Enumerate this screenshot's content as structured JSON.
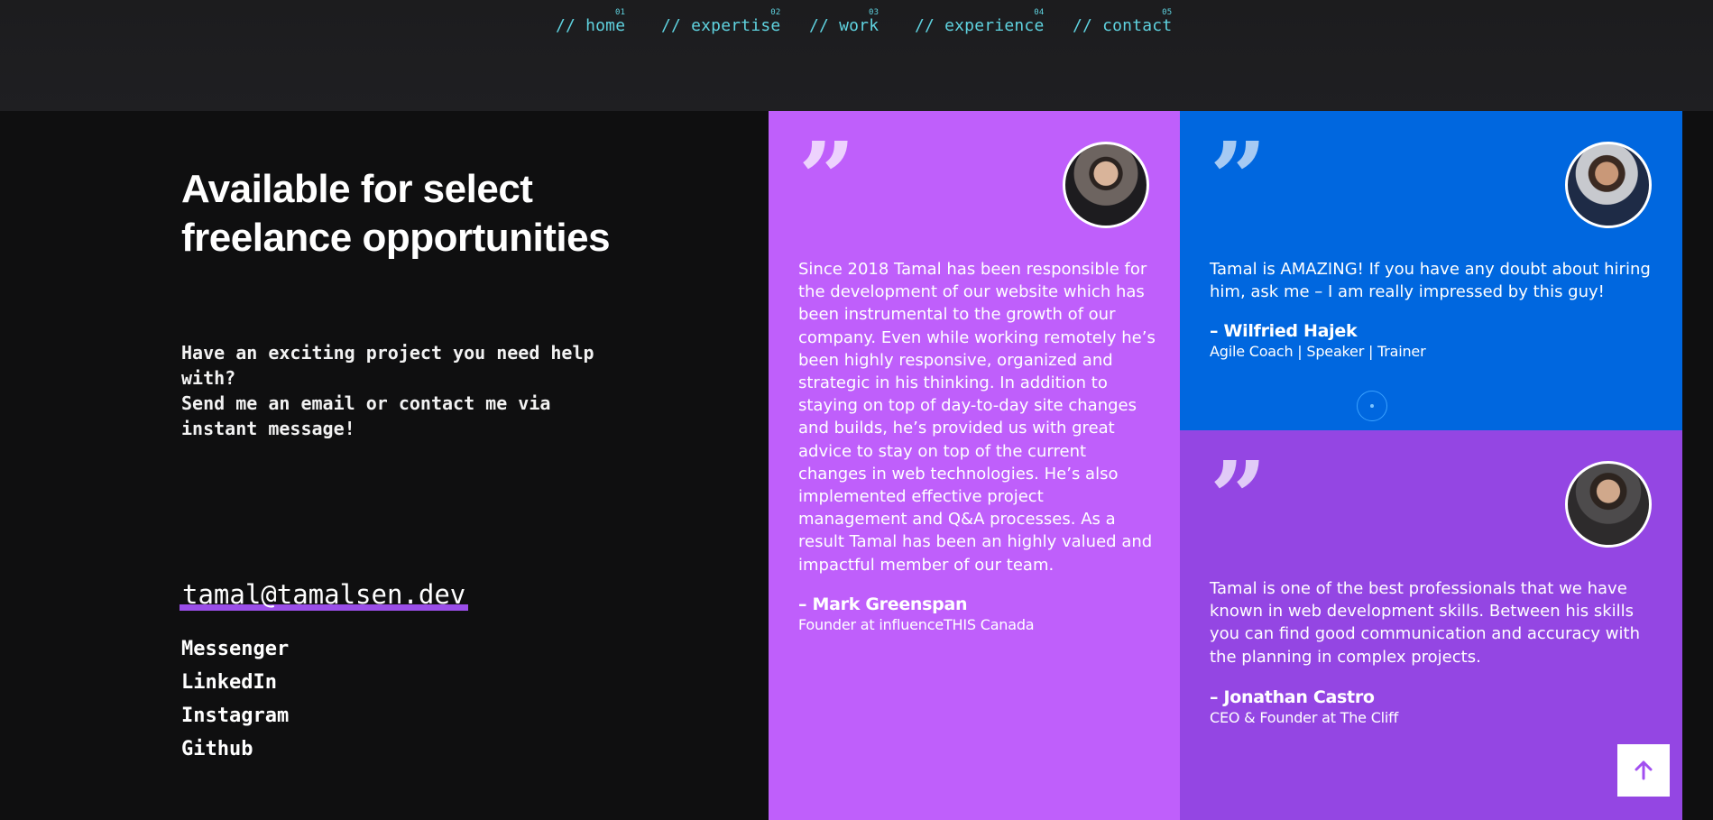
{
  "nav": {
    "items": [
      {
        "label": "// home",
        "num": "01"
      },
      {
        "label": "// expertise",
        "num": "02"
      },
      {
        "label": "// work",
        "num": "03"
      },
      {
        "label": "// experience",
        "num": "04"
      },
      {
        "label": "// contact",
        "num": "05"
      }
    ]
  },
  "contact": {
    "headline": "Available for select freelance opportunities",
    "intro": [
      "Have an exciting project you need help with?",
      "Send me an email or contact me via instant message!"
    ],
    "email": "tamal@tamalsen.dev",
    "social": [
      "Messenger",
      "LinkedIn",
      "Instagram",
      "Github"
    ]
  },
  "testimonials": [
    {
      "quote": "Since 2018 Tamal has been responsible for the development of our website which has been instrumental to the growth of our company. Even while working remotely he’s been highly responsive, organized and strategic in his thinking. In addition to staying on top of day-to-day site changes and builds, he’s provided us with great advice to stay on top of the current changes in web technologies. He’s also implemented effective project management and Q&A processes. As a result Tamal has been an highly valued and impactful member of our team.",
      "author": "– Mark Greenspan",
      "role": "Founder at influenceTHIS Canada"
    },
    {
      "quote": "Tamal is AMAZING! If you have any doubt about hiring him, ask me – I am really impressed by this guy!",
      "author": "– Wilfried Hajek",
      "role": "Agile Coach | Speaker | Trainer"
    },
    {
      "quote": "Tamal is one of the best professionals that we have known in web development skills. Between his skills you can find good communication and accuracy with the planning in complex projects.",
      "author": "– Jonathan Castro",
      "role": "CEO & Founder at The Cliff"
    }
  ],
  "icons": {
    "quote": "quote-icon",
    "back_to_top": "arrow-up-icon"
  },
  "colors": {
    "nav_link": "#5fd3e0",
    "card_purple": "#bf5ffb",
    "card_blue": "#0067df",
    "card_violet": "#9446e3",
    "email_underline": "#9a4ee8"
  }
}
